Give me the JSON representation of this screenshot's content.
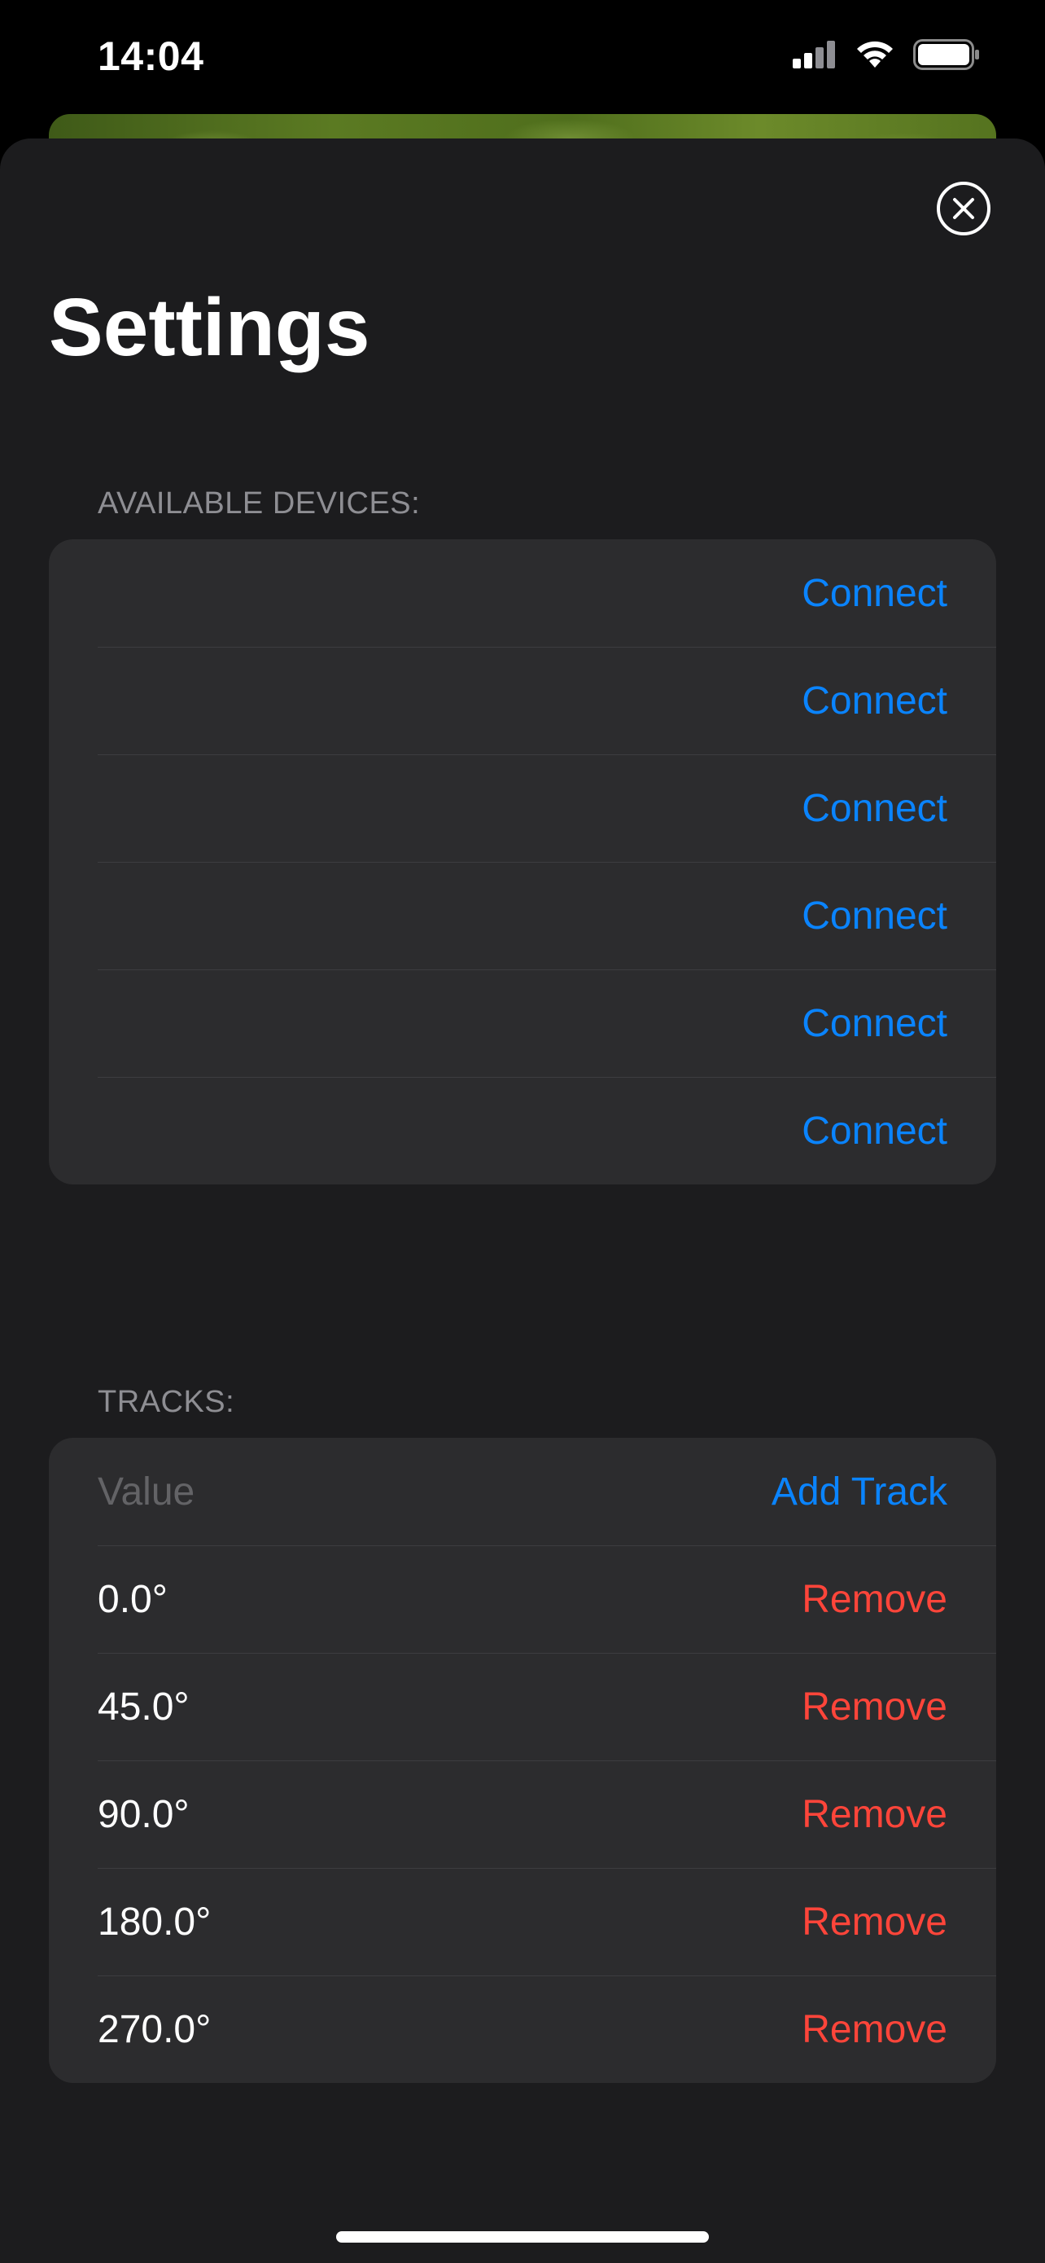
{
  "status_bar": {
    "time": "14:04",
    "icons": [
      "cellular-signal-icon",
      "wifi-icon",
      "battery-icon"
    ]
  },
  "sheet": {
    "title": "Settings",
    "close_icon": "close-circle-icon"
  },
  "devices": {
    "header": "AVAILABLE DEVICES:",
    "rows": [
      {
        "name": "",
        "action": "Connect"
      },
      {
        "name": "",
        "action": "Connect"
      },
      {
        "name": "",
        "action": "Connect"
      },
      {
        "name": "",
        "action": "Connect"
      },
      {
        "name": "",
        "action": "Connect"
      },
      {
        "name": "",
        "action": "Connect"
      }
    ]
  },
  "tracks": {
    "header": "TRACKS:",
    "input": {
      "placeholder": "Value",
      "value": ""
    },
    "add_label": "Add Track",
    "rows": [
      {
        "value": "0.0°",
        "action": "Remove"
      },
      {
        "value": "45.0°",
        "action": "Remove"
      },
      {
        "value": "90.0°",
        "action": "Remove"
      },
      {
        "value": "180.0°",
        "action": "Remove"
      },
      {
        "value": "270.0°",
        "action": "Remove"
      }
    ]
  },
  "colors": {
    "accent": "#0a84ff",
    "destructive": "#ff453a",
    "background": "#1c1c1e",
    "group_background": "#2c2c2e"
  }
}
